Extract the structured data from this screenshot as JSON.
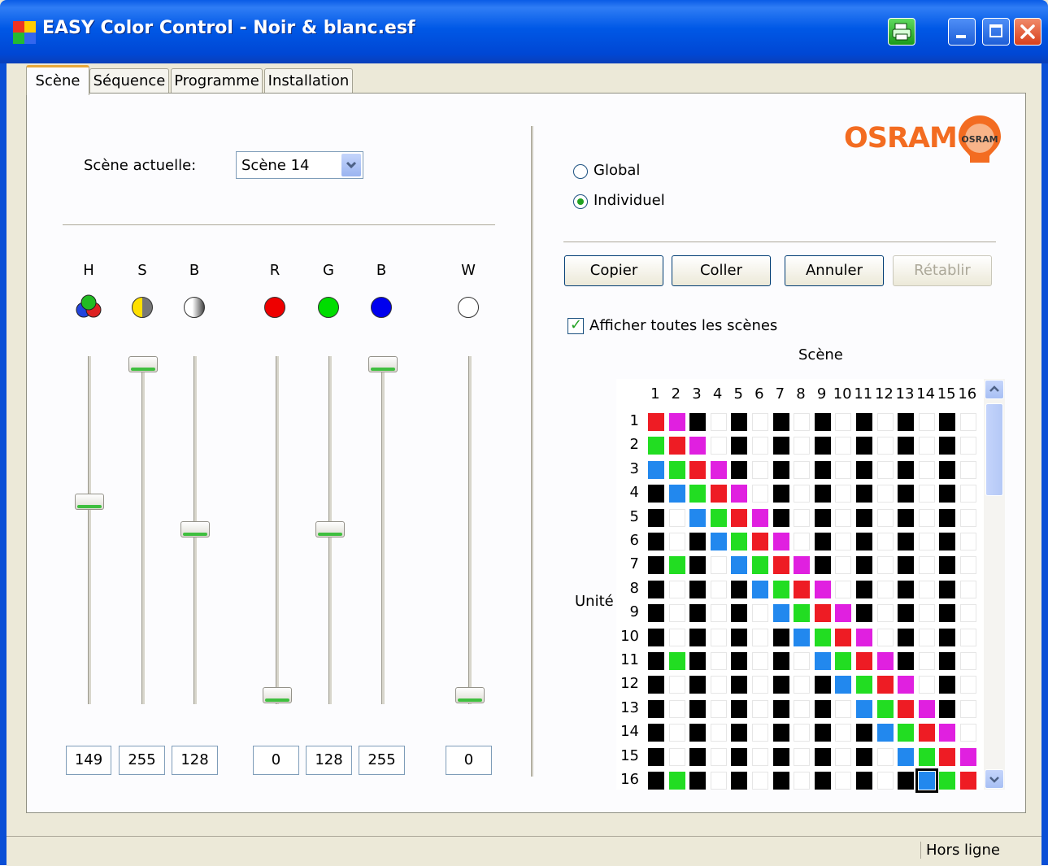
{
  "window": {
    "title": "EASY Color Control - Noir & blanc.esf"
  },
  "tabs": [
    "Scène",
    "Séquence",
    "Programme",
    "Installation"
  ],
  "scene_selector": {
    "label": "Scène actuelle:",
    "value": "Scène 14"
  },
  "channels": [
    {
      "letter": "H",
      "value": "149",
      "level": 0.584
    },
    {
      "letter": "S",
      "value": "255",
      "level": 1.0
    },
    {
      "letter": "B",
      "value": "128",
      "level": 0.502
    },
    {
      "letter": "R",
      "value": "0",
      "level": 0.0
    },
    {
      "letter": "G",
      "value": "128",
      "level": 0.502
    },
    {
      "letter": "B",
      "value": "255",
      "level": 1.0
    },
    {
      "letter": "W",
      "value": "0",
      "level": 0.0
    }
  ],
  "logo": {
    "text": "OSRAM",
    "bulb_text": "OSRAM"
  },
  "mode": {
    "global_label": "Global",
    "individual_label": "Individuel",
    "selected": "Individuel"
  },
  "actions": {
    "copy": "Copier",
    "paste": "Coller",
    "cancel": "Annuler",
    "redo": "Rétablir"
  },
  "show_all": {
    "label": "Afficher toutes les scènes",
    "checked": true
  },
  "grid": {
    "scene_axis_label": "Scène",
    "unit_axis_label": "Unité",
    "columns": [
      "1",
      "2",
      "3",
      "4",
      "5",
      "6",
      "7",
      "8",
      "9",
      "10",
      "11",
      "12",
      "13",
      "14",
      "15",
      "16"
    ],
    "rows": [
      "1",
      "2",
      "3",
      "4",
      "5",
      "6",
      "7",
      "8",
      "9",
      "10",
      "11",
      "12",
      "13",
      "14",
      "15",
      "16"
    ],
    "selected": {
      "row": 16,
      "column": 14
    },
    "color_legend": {
      "R": "#ee1c24",
      "G": "#22dd22",
      "B": "#2288ee",
      "M": "#e020e0",
      "K": "#000000",
      "W": "#ffffff"
    },
    "cells": [
      "RMKWKWKWKWKWKWKW",
      "GRMWKWKWKWKWKWKW",
      "BGRMKWKWKWKWKWKW",
      "KBGRMWKWKWKWKWKW",
      "KWBGRMKWKWKWKWKW",
      "KWKBGRMWKWKWKWKW",
      "KGKWBGRMKWKWKWKW",
      "KWKWKBGRMWKWKWKW",
      "KWKWKWBGRMKWKWKW",
      "KWKWKWKBGRMWKWKW",
      "KGKWKWKWBGRMKWKW",
      "KWKWKWKWKBGRMWKW",
      "KWKWKWKWKWBGRMKW",
      "KWKWKWKWKWKBGRMW",
      "KWKWKWKWKWKWBGRM",
      "KGKWKWKWKWKWKBGR"
    ]
  },
  "status": {
    "text": "Hors ligne"
  }
}
